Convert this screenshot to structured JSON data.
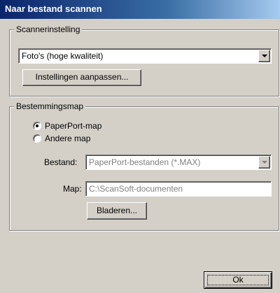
{
  "window": {
    "title": "Naar bestand scannen"
  },
  "scanner_settings": {
    "group_label": "Scannerinstelling",
    "profile_select": {
      "value": "Foto's (hoge kwaliteit)"
    },
    "customize_button_label": "Instellingen aanpassen..."
  },
  "destination": {
    "group_label": "Bestemmingsmap",
    "radio_options": [
      {
        "label": "PaperPort-map",
        "selected": true
      },
      {
        "label": "Andere map",
        "selected": false
      }
    ],
    "file_label": "Bestand:",
    "file_type_select": {
      "value": "PaperPort-bestanden (*.MAX)",
      "disabled": true
    },
    "folder_label": "Map:",
    "folder_input": {
      "value": "C:\\ScanSoft-documenten",
      "disabled": true
    },
    "browse_button_label": "Bladeren..."
  },
  "footer": {
    "ok_button_label": "Ok"
  },
  "colors": {
    "dialog_face": "#d4d0c8",
    "title_bar_start": "#0a246a",
    "title_bar_end": "#a6caf0",
    "disabled_text": "#808080"
  },
  "icons": {
    "dropdown": "chevron-down-icon"
  }
}
